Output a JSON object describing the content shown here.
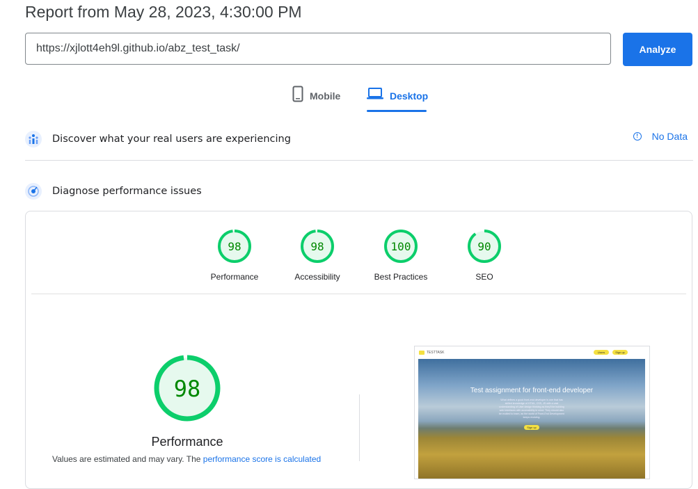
{
  "report_title": "Report from May 28, 2023, 4:30:00 PM",
  "url_input": {
    "value": "https://xjlott4eh9l.github.io/abz_test_task/"
  },
  "analyze_label": "Analyze",
  "tabs": [
    {
      "label": "Mobile",
      "icon": "phone-icon",
      "active": false
    },
    {
      "label": "Desktop",
      "icon": "laptop-icon",
      "active": true
    }
  ],
  "field_data": {
    "title": "Discover what your real users are experiencing",
    "status": "No Data",
    "icon": "users-chart-icon"
  },
  "lab_data": {
    "title": "Diagnose performance issues",
    "icon": "radar-icon"
  },
  "scores": [
    {
      "label": "Performance",
      "value": "98",
      "fraction": 0.98
    },
    {
      "label": "Accessibility",
      "value": "98",
      "fraction": 0.98
    },
    {
      "label": "Best Practices",
      "value": "100",
      "fraction": 1.0
    },
    {
      "label": "SEO",
      "value": "90",
      "fraction": 0.9
    }
  ],
  "main_score": {
    "label": "Performance",
    "value": "98",
    "fraction": 0.98
  },
  "note": {
    "text": "Values are estimated and may vary. The ",
    "link": "performance score is calculated"
  },
  "colors": {
    "accent": "#1a73e8",
    "pass": "#0cce6b",
    "pass_text": "#008800",
    "pass_fill": "#e6f9ee"
  },
  "screenshot": {
    "brand": "TESTTASK",
    "nav_users": "Users",
    "nav_signup": "Sign up",
    "heading": "Test assignment for front-end developer",
    "paragraph": "What defines a good front-end developer is one that has skilled knowledge of HTML, CSS, JS with a vast understanding of User design thinking as they'll be building web interfaces with accessibility in mind. They should also be excited to learn, as the world of Front-End Development keeps evolving.",
    "button": "Sign up"
  }
}
